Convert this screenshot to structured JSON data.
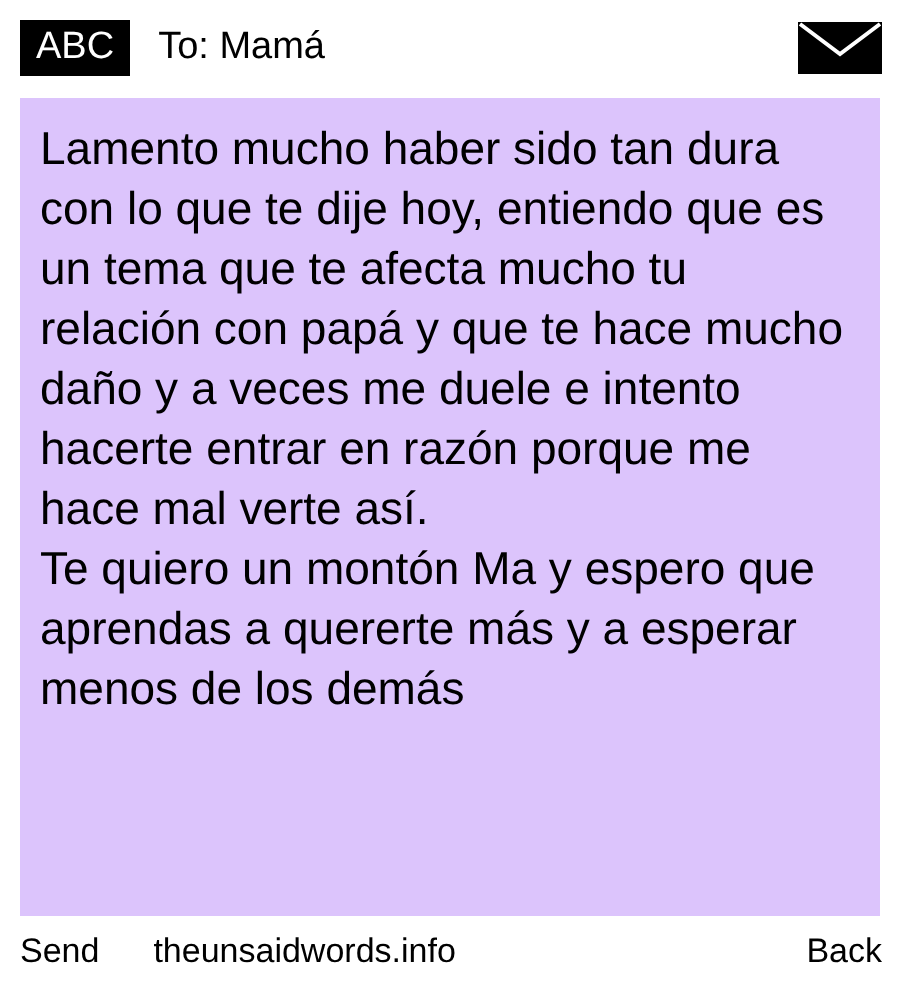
{
  "header": {
    "badge": "ABC",
    "recipient": "To: Mamá"
  },
  "message": {
    "paragraphs": [
      "Lamento mucho haber sido tan dura con lo que te dije hoy, entiendo que es un tema que te afecta mucho tu relación con papá y que te hace mucho daño y a veces me duele e intento hacerte entrar en razón porque me hace mal verte así.",
      "Te quiero un montón Ma y espero que aprendas a quererte más y a esperar menos de los demás"
    ]
  },
  "footer": {
    "send": "Send",
    "site": "theunsaidwords.info",
    "back": "Back"
  }
}
